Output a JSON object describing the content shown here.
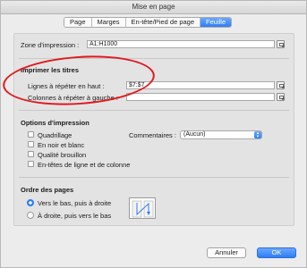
{
  "window": {
    "title": "Mise en page"
  },
  "tabs": [
    {
      "label": "Page",
      "active": false
    },
    {
      "label": "Marges",
      "active": false
    },
    {
      "label": "En-tête/Pied de page",
      "active": false
    },
    {
      "label": "Feuille",
      "active": true
    }
  ],
  "print_area": {
    "label": "Zone d'impression :",
    "value": "A1:H1000"
  },
  "print_titles": {
    "heading": "Imprimer les titres",
    "rows_label": "Lignes à répéter en haut :",
    "rows_value": "$7:$7",
    "cols_label": "Colonnes à répéter à gauche :",
    "cols_value": ""
  },
  "print_options": {
    "heading": "Options d'impression",
    "gridlines": "Quadrillage",
    "black_white": "En noir et blanc",
    "draft": "Qualité brouillon",
    "headings": "En-têtes de ligne et de colonne",
    "comments_label": "Commentaires :",
    "comments_value": "(Aucun)"
  },
  "page_order": {
    "heading": "Ordre des pages",
    "down_then_over": "Vers le bas, puis à droite",
    "over_then_down": "À droite, puis vers le bas",
    "selected": "down_then_over"
  },
  "buttons": {
    "cancel": "Annuler",
    "ok": "OK"
  },
  "colors": {
    "accent": "#2f7df6",
    "annotation": "#e0191c"
  }
}
